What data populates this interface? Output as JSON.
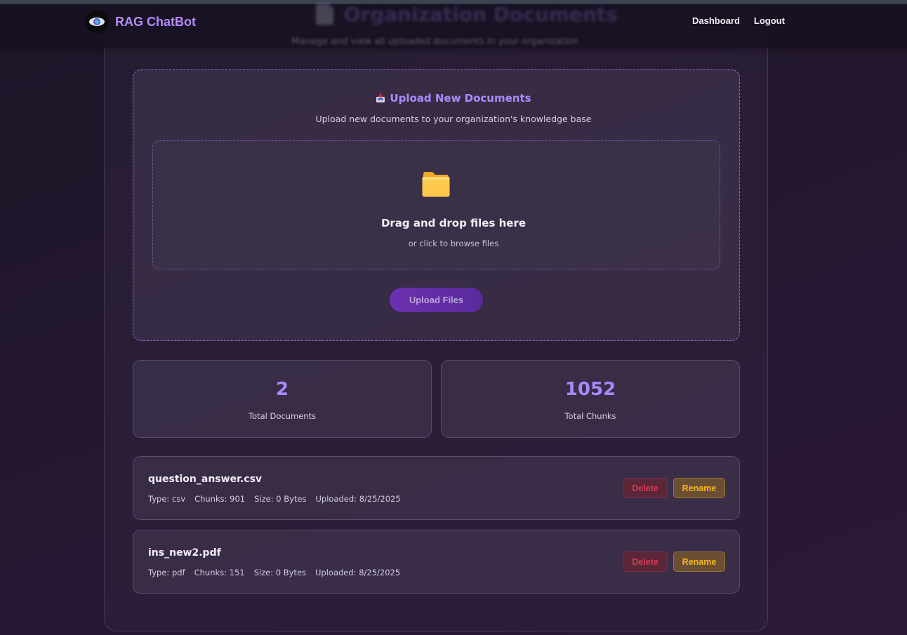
{
  "app": {
    "brand": "RAG ChatBot"
  },
  "nav": {
    "dashboard": "Dashboard",
    "logout": "Logout"
  },
  "header": {
    "ghost_title": "📄 Organization Documents",
    "ghost_sub": "Manage and view all uploaded documents in your organization"
  },
  "upload": {
    "title": "Upload New Documents",
    "subtitle": "Upload new documents to your organization's knowledge base",
    "drop_title": "Drag and drop files here",
    "drop_sub": "or click to browse files",
    "button": "Upload Files"
  },
  "stats": {
    "documents": {
      "value": "2",
      "label": "Total Documents"
    },
    "chunks": {
      "value": "1052",
      "label": "Total Chunks"
    }
  },
  "documents": [
    {
      "name": "question_answer.csv",
      "type": "Type: csv",
      "chunks": "Chunks: 901",
      "size": "Size: 0 Bytes",
      "uploaded": "Uploaded: 8/25/2025",
      "delete": "Delete",
      "rename": "Rename"
    },
    {
      "name": "ins_new2.pdf",
      "type": "Type: pdf",
      "chunks": "Chunks: 151",
      "size": "Size: 0 Bytes",
      "uploaded": "Uploaded: 8/25/2025",
      "delete": "Delete",
      "rename": "Rename"
    }
  ],
  "colors": {
    "accent": "#a98bff",
    "delete": "#d63a55",
    "rename": "#f5b81c"
  },
  "icons": {
    "logo": "eye-logo-icon",
    "upload": "inbox-tray-icon",
    "dropzone": "folder-icon"
  }
}
